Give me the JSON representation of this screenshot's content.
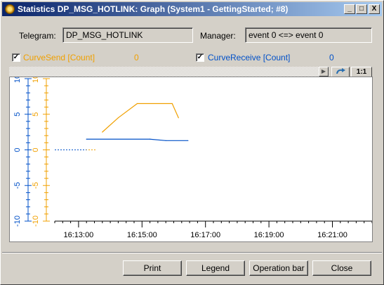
{
  "window": {
    "title": "Statistics DP_MSG_HOTLINK: Graph (System1 - GettingStarted; #8)",
    "minimize_label": "_",
    "maximize_label": "□",
    "close_label": "X"
  },
  "info": {
    "telegram_label": "Telegram:",
    "telegram_value": "DP_MSG_HOTLINK",
    "manager_label": "Manager:",
    "manager_value": "event  0 <=> event  0"
  },
  "legend": [
    {
      "name": "CurveSend [Count]",
      "value": "0",
      "checked": true,
      "color": "#f0a000"
    },
    {
      "name": "CurveReceive [Count]",
      "value": "0",
      "checked": true,
      "color": "#0050c8"
    }
  ],
  "toolbar": {
    "zoom_label": "1:1",
    "scroll_right_icon": "triangle-right-icon",
    "undo_icon": "curved-arrow-icon"
  },
  "colors": {
    "send": "#f0a000",
    "receive": "#0050c8"
  },
  "chart_data": {
    "type": "line",
    "x_tick_labels": [
      "16:13:00",
      "16:15:00",
      "16:17:00",
      "16:19:00",
      "16:21:00"
    ],
    "y_axes": [
      {
        "name": "CurveReceive [Count]",
        "color": "#0050c8",
        "tick_labels": [
          "10",
          "5",
          "0",
          "-5",
          "-10"
        ],
        "ylim": [
          -10,
          10
        ]
      },
      {
        "name": "CurveSend [Count]",
        "color": "#f0a000",
        "tick_labels": [
          "10",
          "5",
          "0",
          "-5",
          "-10"
        ],
        "ylim": [
          -10,
          10
        ]
      }
    ],
    "xlim_minutes": [
      0,
      10
    ],
    "x_tick_values_minutes": [
      0.75,
      2.75,
      4.75,
      6.75,
      8.75
    ],
    "series": [
      {
        "name": "CurveSend [Count]",
        "color": "#f0a000",
        "points": [
          [
            1.5,
            2.5
          ],
          [
            2.0,
            4.5
          ],
          [
            2.6,
            6.5
          ],
          [
            3.7,
            6.5
          ],
          [
            3.9,
            4.5
          ]
        ],
        "dashed_points": [
          [
            0,
            0
          ],
          [
            1.3,
            0
          ]
        ]
      },
      {
        "name": "CurveReceive [Count]",
        "color": "#0050c8",
        "points": [
          [
            1.0,
            1.5
          ],
          [
            3.0,
            1.5
          ],
          [
            3.5,
            1.3
          ],
          [
            4.2,
            1.3
          ]
        ],
        "dashed_points": [
          [
            0,
            0
          ],
          [
            1.0,
            0
          ]
        ]
      }
    ]
  },
  "buttons": {
    "print": "Print",
    "legend": "Legend",
    "operation_bar": "Operation bar",
    "close": "Close"
  }
}
